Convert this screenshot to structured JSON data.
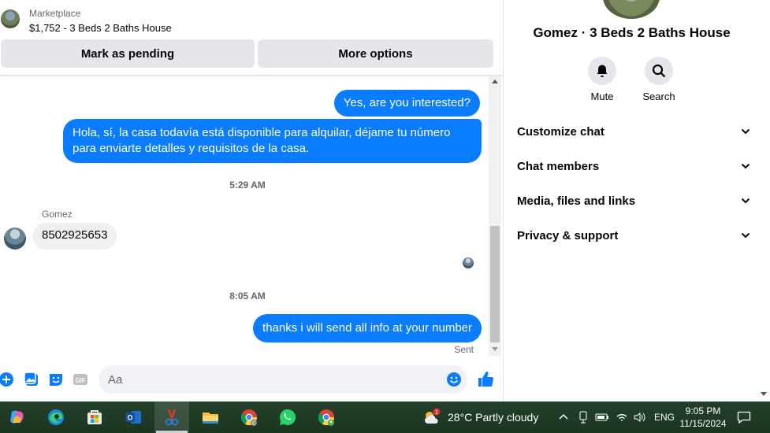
{
  "marketplace": {
    "label": "Marketplace",
    "title": "$1,752 - 3 Beds 2 Baths House"
  },
  "actions": {
    "pending_label": "Mark as pending",
    "more_label": "More options"
  },
  "messages": {
    "out1": "Yes, are you interested?",
    "out2": "Hola, sí, la casa todavía está disponible para alquilar, déjame tu número para enviarte detalles y requisitos de la casa.",
    "time1": "5:29 AM",
    "sender_name": "Gomez",
    "in1": "8502925653",
    "time2": "8:05 AM",
    "out3": "thanks i will send all info at your number",
    "status": "Sent"
  },
  "composer": {
    "placeholder": "Aa"
  },
  "details": {
    "name": "Gomez · 3 Beds 2 Baths House",
    "mute_label": "Mute",
    "search_label": "Search",
    "sections": [
      {
        "label": "Customize chat"
      },
      {
        "label": "Chat members"
      },
      {
        "label": "Media, files and links"
      },
      {
        "label": "Privacy & support"
      }
    ]
  },
  "taskbar": {
    "apps": [
      "copilot-icon",
      "edge-icon",
      "store-icon",
      "outlook-icon",
      "snipping-tool-icon",
      "file-explorer-icon",
      "chrome-icon",
      "whatsapp-icon",
      "chrome-profile-icon"
    ],
    "weather_badge": "1",
    "weather": "28°C  Partly cloudy",
    "language": "ENG",
    "time": "9:05 PM",
    "date": "11/15/2024"
  },
  "colors": {
    "accent": "#0a7cff",
    "taskbar": "#1f3b24"
  }
}
